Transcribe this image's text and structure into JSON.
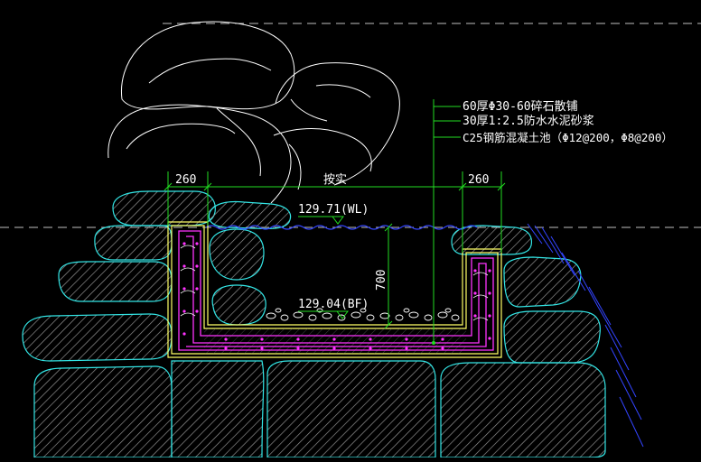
{
  "annotations": {
    "layer_1": "60厚Φ30-60碎石散铺",
    "layer_2": "30厚1:2.5防水水泥砂浆",
    "layer_3": "C25钢筋混凝土池（Φ12@200，Φ8@200）"
  },
  "dimensions": {
    "left_width": "260",
    "right_width": "260",
    "span": "按实",
    "depth": "700"
  },
  "levels": {
    "water_level": "129.71(WL)",
    "bottom_level": "129.04(BF)"
  },
  "colors": {
    "background": "#000000",
    "rock_outline": "#ffffff",
    "stone": "#33e6e6",
    "concrete": "#ffff66",
    "rebar": "#ff33ff",
    "dimension": "#22dd22",
    "water": "#3344ff",
    "text": "#ffffff"
  }
}
